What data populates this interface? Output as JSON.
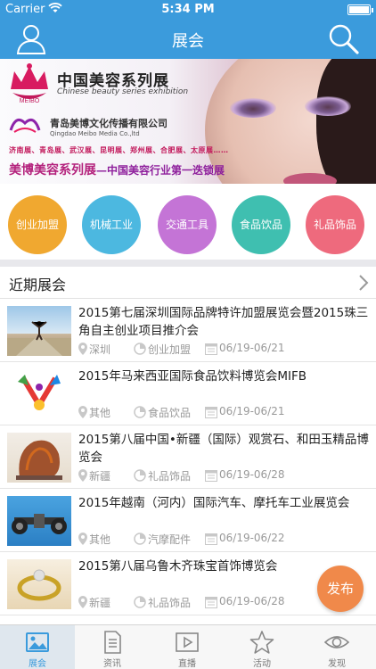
{
  "status": {
    "carrier": "Carrier",
    "time": "5:34 PM"
  },
  "nav": {
    "title": "展会",
    "user_icon": "user-icon",
    "search_icon": "search-icon"
  },
  "banner": {
    "title": "中国美容系列展",
    "subtitle": "Chinese beauty series exhibition",
    "company": "青岛美博文化传播有限公司",
    "company_en": "Qingdao Meibo Media Co.,ltd",
    "cities": "济南展、青岛展、武汉展、昆明展、郑州展、合肥展、太原展……",
    "slogan_a": "美博美容系列展",
    "slogan_b": "—中国美容行业第一迭锁展"
  },
  "categories": [
    {
      "label": "创业加盟",
      "color": "#f0a830"
    },
    {
      "label": "机械工业",
      "color": "#4cb8e0"
    },
    {
      "label": "交通工具",
      "color": "#c474d6"
    },
    {
      "label": "食品饮品",
      "color": "#3fbfb0"
    },
    {
      "label": "礼品饰品",
      "color": "#ee6a7d"
    }
  ],
  "section": {
    "title": "近期展会"
  },
  "items": [
    {
      "title": "2015第七届深圳国际品牌特许加盟展览会暨2015珠三角自主创业项目推介会",
      "city": "深圳",
      "category": "创业加盟",
      "dates": "06/19-06/21"
    },
    {
      "title": "2015年马来西亚国际食品饮料博览会MIFB",
      "city": "其他",
      "category": "食品饮品",
      "dates": "06/19-06/21"
    },
    {
      "title": "2015第八届中国•新疆（国际）观赏石、和田玉精品博览会",
      "city": "新疆",
      "category": "礼品饰品",
      "dates": "06/19-06/28"
    },
    {
      "title": "2015年越南（河内）国际汽车、摩托车工业展览会",
      "city": "其他",
      "category": "汽摩配件",
      "dates": "06/19-06/22"
    },
    {
      "title": "2015第八届乌鲁木齐珠宝首饰博览会",
      "city": "新疆",
      "category": "礼品饰品",
      "dates": "06/19-06/28"
    }
  ],
  "publish_label": "发布",
  "tabs": [
    {
      "label": "展会",
      "icon": "image-icon",
      "active": true
    },
    {
      "label": "资讯",
      "icon": "document-icon"
    },
    {
      "label": "直播",
      "icon": "play-icon"
    },
    {
      "label": "活动",
      "icon": "star-icon"
    },
    {
      "label": "发现",
      "icon": "eye-icon"
    }
  ],
  "colors": {
    "primary": "#3b9bdc",
    "publish": "#f0894a"
  }
}
